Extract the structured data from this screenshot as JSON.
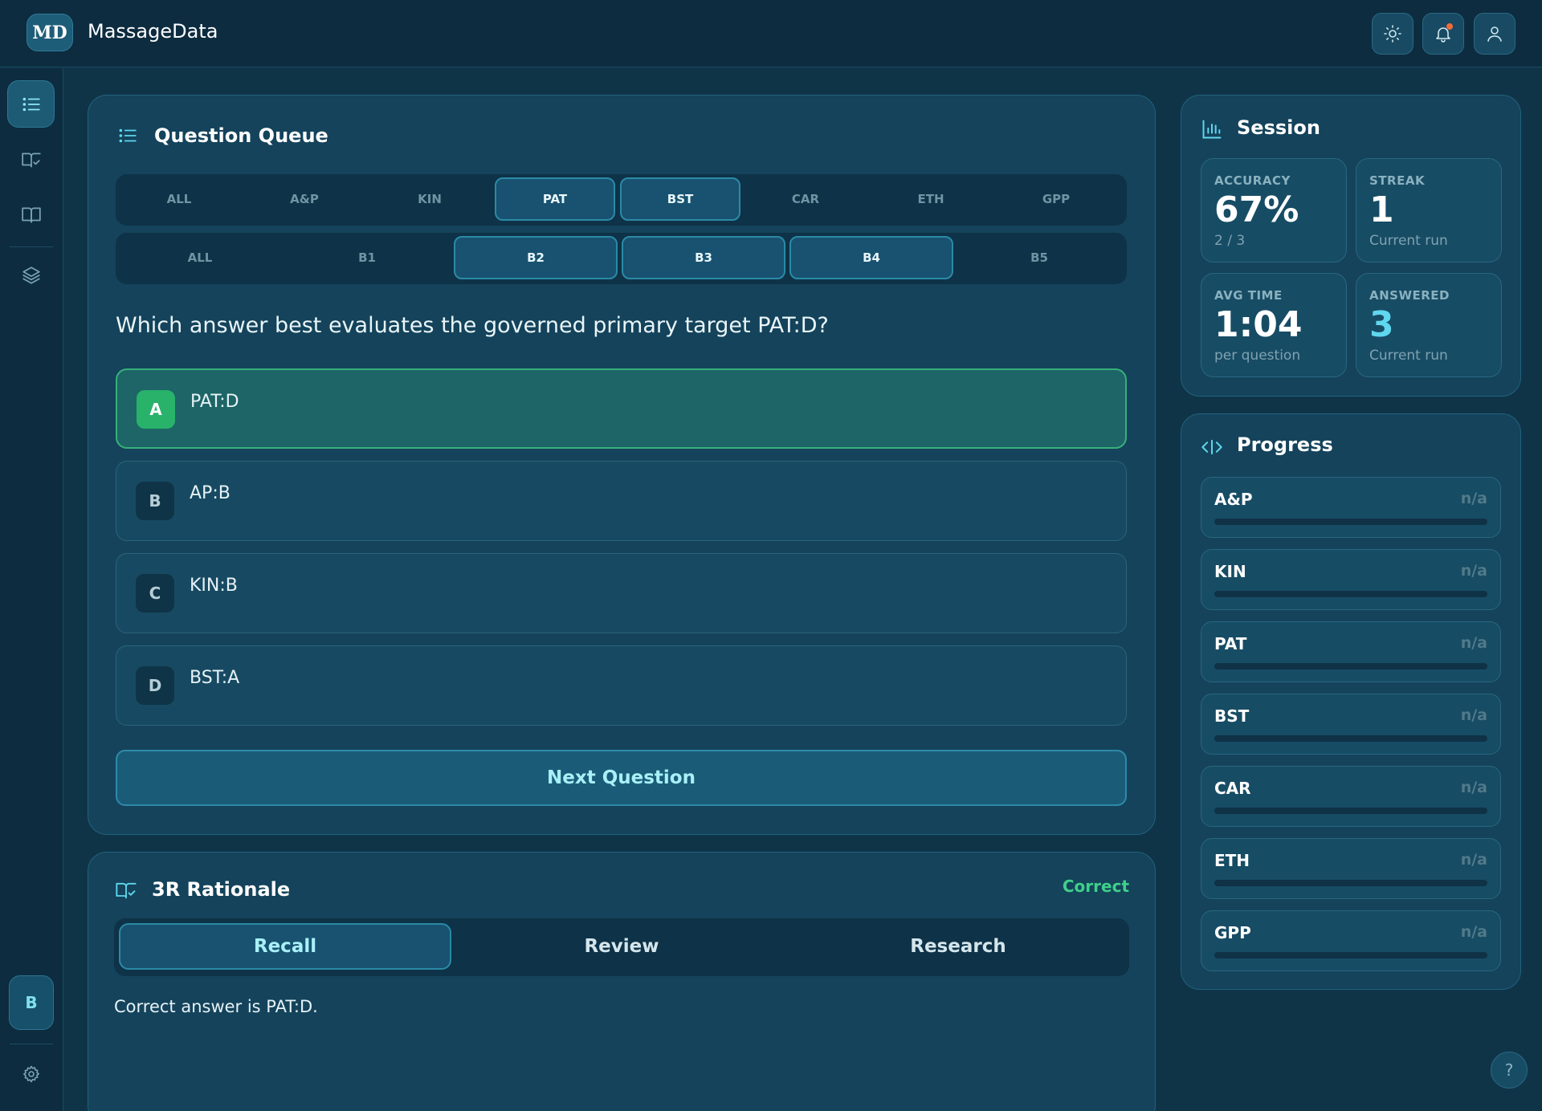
{
  "app": {
    "logo_text": "MD",
    "title": "MassageData"
  },
  "queue": {
    "title": "Question Queue",
    "subject_chips": [
      {
        "label": "ALL",
        "selected": false
      },
      {
        "label": "A&P",
        "selected": false
      },
      {
        "label": "KIN",
        "selected": false
      },
      {
        "label": "PAT",
        "selected": true
      },
      {
        "label": "BST",
        "selected": true
      },
      {
        "label": "CAR",
        "selected": false
      },
      {
        "label": "ETH",
        "selected": false
      },
      {
        "label": "GPP",
        "selected": false
      }
    ],
    "block_chips": [
      {
        "label": "ALL",
        "selected": false
      },
      {
        "label": "B1",
        "selected": false
      },
      {
        "label": "B2",
        "selected": true
      },
      {
        "label": "B3",
        "selected": true
      },
      {
        "label": "B4",
        "selected": true
      },
      {
        "label": "B5",
        "selected": false
      }
    ],
    "question": "Which answer best evaluates the governed primary target PAT:D?",
    "options": [
      {
        "letter": "A",
        "text": "PAT:D",
        "correct": true
      },
      {
        "letter": "B",
        "text": "AP:B",
        "correct": false
      },
      {
        "letter": "C",
        "text": "KIN:B",
        "correct": false
      },
      {
        "letter": "D",
        "text": "BST:A",
        "correct": false
      }
    ],
    "next_label": "Next Question"
  },
  "rationale": {
    "title": "3R Rationale",
    "status": "Correct",
    "tabs": [
      {
        "label": "Recall",
        "selected": true
      },
      {
        "label": "Review",
        "selected": false
      },
      {
        "label": "Research",
        "selected": false
      }
    ],
    "text": "Correct answer is PAT:D."
  },
  "session": {
    "title": "Session",
    "stats": [
      {
        "label": "ACCURACY",
        "value": "67%",
        "sub": "2 / 3"
      },
      {
        "label": "STREAK",
        "value": "1",
        "sub": "Current run"
      },
      {
        "label": "AVG TIME",
        "value": "1:04",
        "sub": "per question"
      },
      {
        "label": "ANSWERED",
        "value": "3",
        "sub": "Current run"
      }
    ]
  },
  "progress": {
    "title": "Progress",
    "items": [
      {
        "label": "A&P",
        "value": "n/a",
        "fraction": 0
      },
      {
        "label": "KIN",
        "value": "n/a",
        "fraction": 0
      },
      {
        "label": "PAT",
        "value": "n/a",
        "fraction": 0
      },
      {
        "label": "BST",
        "value": "n/a",
        "fraction": 0
      },
      {
        "label": "CAR",
        "value": "n/a",
        "fraction": 0
      },
      {
        "label": "ETH",
        "value": "n/a",
        "fraction": 0
      },
      {
        "label": "GPP",
        "value": "n/a",
        "fraction": 0
      }
    ]
  },
  "sidebar": {
    "badge_label": "B"
  },
  "help_label": "?",
  "colors": {
    "background": "#0f3448",
    "card": "#14435b",
    "accent": "#3ec7de",
    "correct": "#3fd08a"
  }
}
